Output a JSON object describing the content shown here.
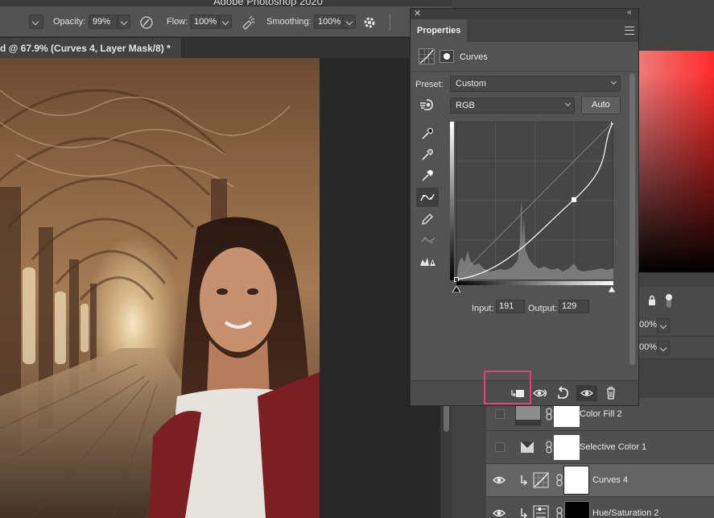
{
  "app": {
    "title": "Adobe Photoshop 2020"
  },
  "options_bar": {
    "opacity_label": "Opacity:",
    "opacity_value": "99%",
    "flow_label": "Flow:",
    "flow_value": "100%",
    "smoothing_label": "Smoothing:",
    "smoothing_value": "100%",
    "icons": [
      "pressure-opacity-icon",
      "airbrush-icon",
      "gear-icon"
    ]
  },
  "document_tab": {
    "title": "d @ 67.9% (Curves 4, Layer Mask/8) *"
  },
  "properties": {
    "tab_label": "Properties",
    "adjustment_name": "Curves",
    "preset_label": "Preset:",
    "preset_value": "Custom",
    "channel_value": "RGB",
    "auto_label": "Auto",
    "input_label": "Input:",
    "input_value": "191",
    "output_label": "Output:",
    "output_value": "129",
    "tools": [
      "targeted-adjust-icon",
      "black-point-eyedropper-icon",
      "gray-point-eyedropper-icon",
      "white-point-eyedropper-icon",
      "curve-point-icon",
      "pencil-icon",
      "smooth-curve-icon",
      "clipping-warning-icon"
    ],
    "footer_buttons": [
      "clip-to-layer-button",
      "view-previous-button",
      "reset-button",
      "toggle-visibility-button",
      "delete-button"
    ],
    "curve": {
      "points": [
        [
          0,
          0
        ],
        [
          191,
          129
        ],
        [
          255,
          255
        ]
      ],
      "channel": "RGB"
    }
  },
  "right_panel": {
    "percent_1": "00%",
    "percent_2": "00%"
  },
  "layers": [
    {
      "name": "Color Fill 2",
      "visible": false,
      "clipped": false,
      "type": "color-fill",
      "selected": false
    },
    {
      "name": "Selective Color 1",
      "visible": false,
      "clipped": false,
      "type": "selective-color",
      "selected": false
    },
    {
      "name": "Curves 4",
      "visible": true,
      "clipped": true,
      "type": "curves",
      "selected": true
    },
    {
      "name": "Hue/Saturation 2",
      "visible": true,
      "clipped": true,
      "type": "hue-saturation",
      "selected": false
    }
  ],
  "colors": {
    "panel_bg": "#535353",
    "highlight": "#ef3a7c",
    "selected_layer": "#646464"
  }
}
